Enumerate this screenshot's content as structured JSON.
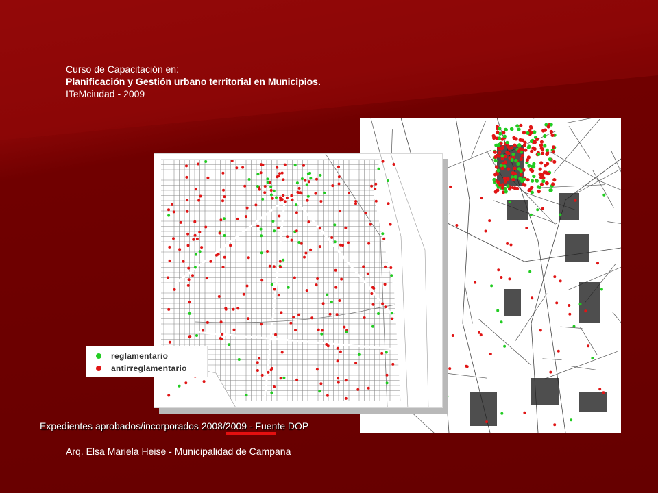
{
  "header": {
    "line1": "Curso de Capacitación en:",
    "line2": "Planificación y Gestión urbano territorial en Municipios.",
    "line3": "ITeMciudad - 2009"
  },
  "legend": {
    "items": [
      {
        "label": "reglamentario",
        "color": "#22cc22"
      },
      {
        "label": "antirreglamentario",
        "color": "#e01515"
      }
    ]
  },
  "caption": "Expedientes aprobados/incorporados 2008/2009 - Fuente DOP",
  "footer": "Arq. Elsa Mariela Heise - Municipalidad de Campana",
  "colors": {
    "background": "#6e0000",
    "accent_underline": "#e31010",
    "compliant": "#22cc22",
    "non_compliant": "#e01515"
  }
}
